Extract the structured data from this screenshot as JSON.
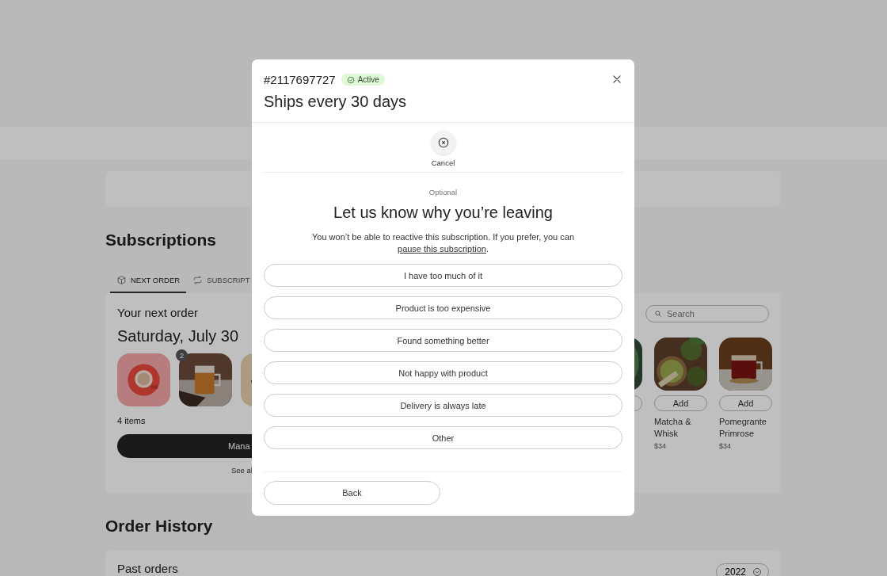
{
  "page": {
    "section_title": "Subscriptions",
    "tabs": [
      {
        "label": "NEXT ORDER",
        "selected": true
      },
      {
        "label": "SUBSCRIPT",
        "selected": false
      }
    ],
    "next_order": {
      "label": "Your next order",
      "date": "Saturday, July 30",
      "items": [
        {
          "kind": "picture"
        },
        {
          "kind": "picture",
          "badge": "2"
        },
        {
          "kind": "picture"
        }
      ],
      "count": "4 items",
      "manage_button": "Mana",
      "see_all_link": "See al"
    },
    "search": {
      "placeholder": "Search"
    },
    "products": [
      {
        "kind": "picture"
      },
      {
        "kind": "picture",
        "add": "Add",
        "name": "Matcha & Whisk",
        "price": "$34"
      },
      {
        "kind": "picture",
        "add": "Add",
        "name": "Pomegrante Primrose",
        "price": "$34"
      }
    ],
    "history_title": "Order History",
    "past_orders": "Past orders",
    "year": "2022"
  },
  "modal": {
    "order_id": "#2117697727",
    "status": "Active",
    "title": "Ships every 30 days",
    "action": "Cancel",
    "optional": "Optional",
    "heading": "Let us know why you’re leaving",
    "message": "You won’t be able to reactive this subscription. If you prefer, you can ",
    "message_link": "pause this subscription",
    "message_end": ".",
    "reasons": [
      "I have too much of it",
      "Product is too expensive",
      "Found something better",
      "Not happy with product",
      "Delivery is always late",
      "Other"
    ],
    "back": "Back"
  }
}
